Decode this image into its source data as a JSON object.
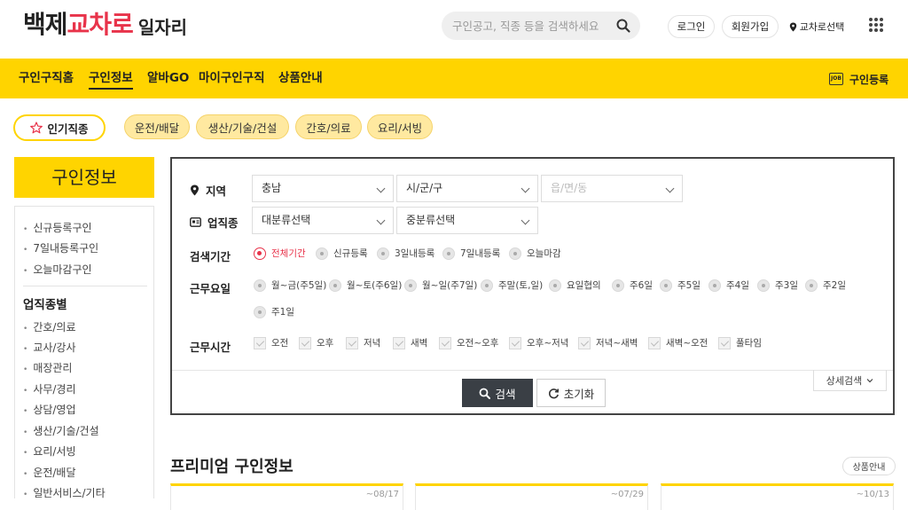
{
  "header": {
    "logo": {
      "part1": "백제",
      "part2": "교차로",
      "part3": "일자리"
    },
    "search_placeholder": "구인공고, 직종 등을 검색하세요",
    "login": "로그인",
    "signup": "회원가입",
    "region_select": "교차로선택"
  },
  "nav": {
    "items": [
      "구인구직홈",
      "구인정보",
      "알바GO",
      "마이구인구직",
      "상품안내"
    ],
    "active": "구인정보",
    "register_label": "구인등록",
    "register_icon_text": "JOB"
  },
  "popular": {
    "label": "인기직종",
    "chips": [
      "운전/배달",
      "생산/기술/건설",
      "간호/의료",
      "요리/서빙"
    ]
  },
  "sidebar": {
    "title": "구인정보",
    "top_items": [
      "신규등록구인",
      "7일내등록구인",
      "오늘마감구인"
    ],
    "category_heading": "업직종별",
    "categories": [
      "간호/의료",
      "교사/강사",
      "매장관리",
      "사무/경리",
      "상담/영업",
      "생산/기술/건설",
      "요리/서빙",
      "운전/배달",
      "일반서비스/기타"
    ]
  },
  "filter": {
    "region_label": "지역",
    "region_values": [
      "충남",
      "시/군/구",
      "읍/면/동"
    ],
    "job_label": "업직종",
    "job_values": [
      "대분류선택",
      "중분류선택"
    ],
    "period_label": "검색기간",
    "period_options": [
      "전체기간",
      "신규등록",
      "3일내등록",
      "7일내등록",
      "오늘마감"
    ],
    "period_selected": "전체기간",
    "days_label": "근무요일",
    "days_options": [
      "월~금(주5일)",
      "월~토(주6일)",
      "월~일(주7일)",
      "주말(토,일)",
      "요일협의",
      "주6일",
      "주5일",
      "주4일",
      "주3일",
      "주2일",
      "주1일"
    ],
    "time_label": "근무시간",
    "time_options": [
      "오전",
      "오후",
      "저녁",
      "새벽",
      "오전~오후",
      "오후~저녁",
      "저녁~새벽",
      "새벽~오전",
      "풀타임"
    ],
    "detail_label": "상세검색",
    "search_label": "검색",
    "reset_label": "초기화"
  },
  "premium": {
    "title": "프리미엄 구인정보",
    "product_label": "상품안내",
    "card_dates": [
      "~08/17",
      "~07/29",
      "~10/13"
    ]
  },
  "colors": {
    "brand_yellow": "#ffd400",
    "accent_red": "#e8334a",
    "dark_button": "#3a3f45"
  }
}
